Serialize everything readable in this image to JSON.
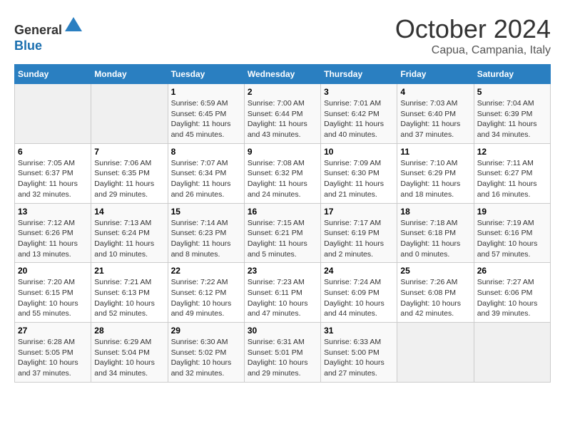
{
  "header": {
    "logo_line1": "General",
    "logo_line2": "Blue",
    "month": "October 2024",
    "location": "Capua, Campania, Italy"
  },
  "weekdays": [
    "Sunday",
    "Monday",
    "Tuesday",
    "Wednesday",
    "Thursday",
    "Friday",
    "Saturday"
  ],
  "weeks": [
    [
      {
        "day": "",
        "info": ""
      },
      {
        "day": "",
        "info": ""
      },
      {
        "day": "1",
        "info": "Sunrise: 6:59 AM\nSunset: 6:45 PM\nDaylight: 11 hours and 45 minutes."
      },
      {
        "day": "2",
        "info": "Sunrise: 7:00 AM\nSunset: 6:44 PM\nDaylight: 11 hours and 43 minutes."
      },
      {
        "day": "3",
        "info": "Sunrise: 7:01 AM\nSunset: 6:42 PM\nDaylight: 11 hours and 40 minutes."
      },
      {
        "day": "4",
        "info": "Sunrise: 7:03 AM\nSunset: 6:40 PM\nDaylight: 11 hours and 37 minutes."
      },
      {
        "day": "5",
        "info": "Sunrise: 7:04 AM\nSunset: 6:39 PM\nDaylight: 11 hours and 34 minutes."
      }
    ],
    [
      {
        "day": "6",
        "info": "Sunrise: 7:05 AM\nSunset: 6:37 PM\nDaylight: 11 hours and 32 minutes."
      },
      {
        "day": "7",
        "info": "Sunrise: 7:06 AM\nSunset: 6:35 PM\nDaylight: 11 hours and 29 minutes."
      },
      {
        "day": "8",
        "info": "Sunrise: 7:07 AM\nSunset: 6:34 PM\nDaylight: 11 hours and 26 minutes."
      },
      {
        "day": "9",
        "info": "Sunrise: 7:08 AM\nSunset: 6:32 PM\nDaylight: 11 hours and 24 minutes."
      },
      {
        "day": "10",
        "info": "Sunrise: 7:09 AM\nSunset: 6:30 PM\nDaylight: 11 hours and 21 minutes."
      },
      {
        "day": "11",
        "info": "Sunrise: 7:10 AM\nSunset: 6:29 PM\nDaylight: 11 hours and 18 minutes."
      },
      {
        "day": "12",
        "info": "Sunrise: 7:11 AM\nSunset: 6:27 PM\nDaylight: 11 hours and 16 minutes."
      }
    ],
    [
      {
        "day": "13",
        "info": "Sunrise: 7:12 AM\nSunset: 6:26 PM\nDaylight: 11 hours and 13 minutes."
      },
      {
        "day": "14",
        "info": "Sunrise: 7:13 AM\nSunset: 6:24 PM\nDaylight: 11 hours and 10 minutes."
      },
      {
        "day": "15",
        "info": "Sunrise: 7:14 AM\nSunset: 6:23 PM\nDaylight: 11 hours and 8 minutes."
      },
      {
        "day": "16",
        "info": "Sunrise: 7:15 AM\nSunset: 6:21 PM\nDaylight: 11 hours and 5 minutes."
      },
      {
        "day": "17",
        "info": "Sunrise: 7:17 AM\nSunset: 6:19 PM\nDaylight: 11 hours and 2 minutes."
      },
      {
        "day": "18",
        "info": "Sunrise: 7:18 AM\nSunset: 6:18 PM\nDaylight: 11 hours and 0 minutes."
      },
      {
        "day": "19",
        "info": "Sunrise: 7:19 AM\nSunset: 6:16 PM\nDaylight: 10 hours and 57 minutes."
      }
    ],
    [
      {
        "day": "20",
        "info": "Sunrise: 7:20 AM\nSunset: 6:15 PM\nDaylight: 10 hours and 55 minutes."
      },
      {
        "day": "21",
        "info": "Sunrise: 7:21 AM\nSunset: 6:13 PM\nDaylight: 10 hours and 52 minutes."
      },
      {
        "day": "22",
        "info": "Sunrise: 7:22 AM\nSunset: 6:12 PM\nDaylight: 10 hours and 49 minutes."
      },
      {
        "day": "23",
        "info": "Sunrise: 7:23 AM\nSunset: 6:11 PM\nDaylight: 10 hours and 47 minutes."
      },
      {
        "day": "24",
        "info": "Sunrise: 7:24 AM\nSunset: 6:09 PM\nDaylight: 10 hours and 44 minutes."
      },
      {
        "day": "25",
        "info": "Sunrise: 7:26 AM\nSunset: 6:08 PM\nDaylight: 10 hours and 42 minutes."
      },
      {
        "day": "26",
        "info": "Sunrise: 7:27 AM\nSunset: 6:06 PM\nDaylight: 10 hours and 39 minutes."
      }
    ],
    [
      {
        "day": "27",
        "info": "Sunrise: 6:28 AM\nSunset: 5:05 PM\nDaylight: 10 hours and 37 minutes."
      },
      {
        "day": "28",
        "info": "Sunrise: 6:29 AM\nSunset: 5:04 PM\nDaylight: 10 hours and 34 minutes."
      },
      {
        "day": "29",
        "info": "Sunrise: 6:30 AM\nSunset: 5:02 PM\nDaylight: 10 hours and 32 minutes."
      },
      {
        "day": "30",
        "info": "Sunrise: 6:31 AM\nSunset: 5:01 PM\nDaylight: 10 hours and 29 minutes."
      },
      {
        "day": "31",
        "info": "Sunrise: 6:33 AM\nSunset: 5:00 PM\nDaylight: 10 hours and 27 minutes."
      },
      {
        "day": "",
        "info": ""
      },
      {
        "day": "",
        "info": ""
      }
    ]
  ]
}
